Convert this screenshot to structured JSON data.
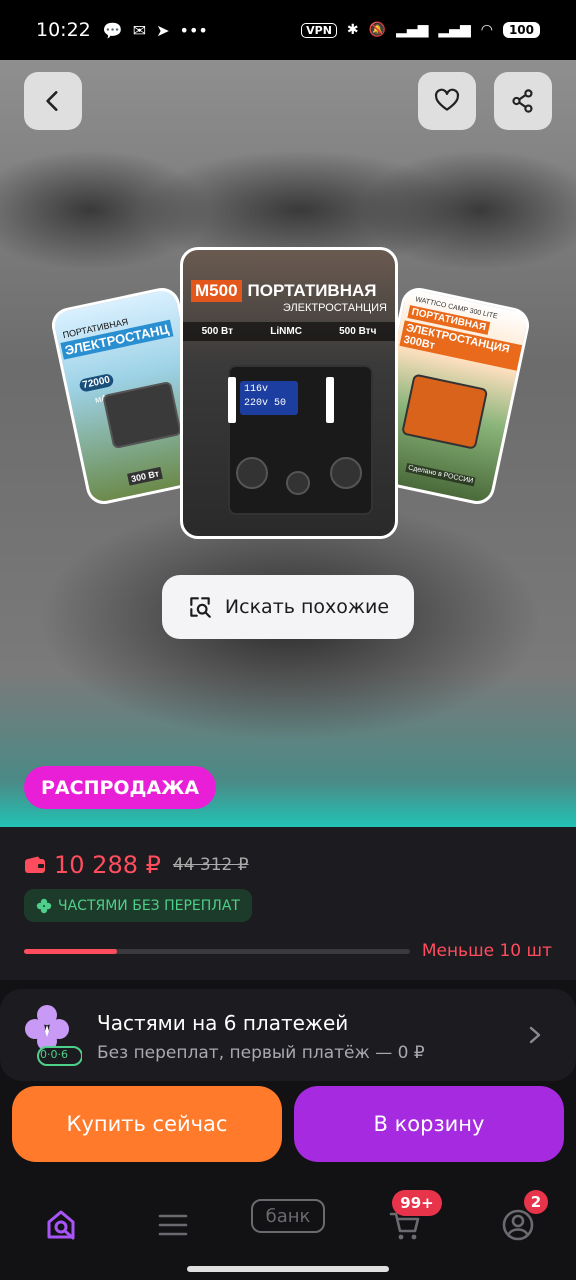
{
  "status_bar": {
    "time": "10:22",
    "vpn": "VPN",
    "battery": "100"
  },
  "hero": {
    "left_card": {
      "line1": "ПОРТАТИВНАЯ",
      "line2": "ЭЛЕКТРОСТАНЦ",
      "capacity": "72000",
      "unit": "мАч",
      "power": "300 Вт"
    },
    "main_card": {
      "model": "M500",
      "title": "ПОРТАТИВНАЯ",
      "subtitle": "ЭЛЕКТРОСТАНЦИЯ",
      "spec_power": "500 Вт",
      "spec_chem": "LiNMC",
      "spec_energy": "500 Втч",
      "screen_line1": "116v",
      "screen_line2": "220v 50"
    },
    "right_card": {
      "line0": "WATTICO CAMP 300 LITE",
      "line1": "ПОРТАТИВНАЯ",
      "line2": "ЭЛЕКТРОСТАНЦИЯ 300Вт",
      "footer": "Сделано в РОССИИ"
    },
    "search_similar_label": "Искать похожие",
    "sale_badge": "РАСПРОДАЖА"
  },
  "price": {
    "current": "10 288 ₽",
    "old": "44 312 ₽",
    "installment_badge": "ЧАСТЯМИ БЕЗ ПЕРЕПЛАТ",
    "stock_text": "Меньше 10 шт",
    "stock_fraction": 0.24
  },
  "installments": {
    "title": "Частями на 6 платежей",
    "subtitle": "Без переплат, первый платёж — 0 ₽",
    "icon_label": "0·0·6"
  },
  "actions": {
    "buy_now": "Купить сейчас",
    "add_to_cart": "В корзину"
  },
  "tabbar": {
    "bank_label": "банк",
    "cart_badge": "99+",
    "profile_badge": "2"
  },
  "colors": {
    "accent_purple": "#a52ae0",
    "accent_orange": "#ff7a2b",
    "price_red": "#ff4d5e",
    "sale_pink": "#e91ed7"
  }
}
